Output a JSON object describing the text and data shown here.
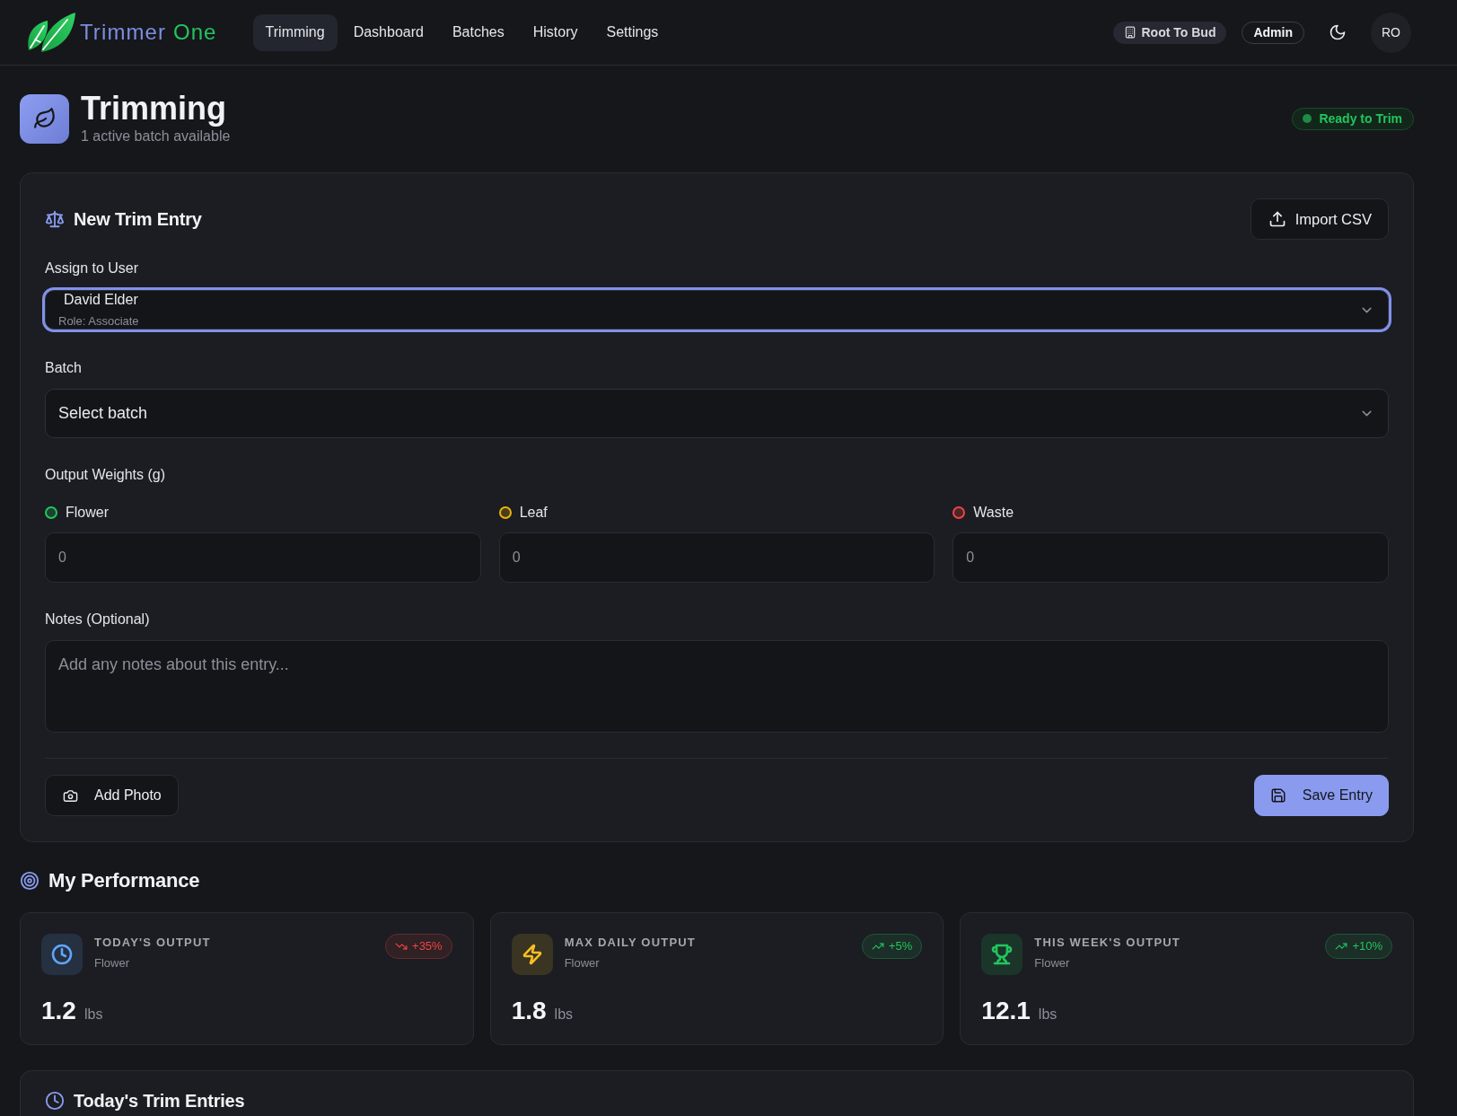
{
  "header": {
    "brand": {
      "name": "Trimmer",
      "suffix": "One"
    },
    "nav": [
      {
        "label": "Trimming",
        "selected": true
      },
      {
        "label": "Dashboard",
        "selected": false
      },
      {
        "label": "Batches",
        "selected": false
      },
      {
        "label": "History",
        "selected": false
      },
      {
        "label": "Settings",
        "selected": false
      }
    ],
    "organization": "Root To Bud",
    "role": "Admin",
    "avatar_initials": "RO"
  },
  "page": {
    "title": "Trimming",
    "subtitle": "1 active batch available",
    "status": "Ready to Trim"
  },
  "trim_form": {
    "title": "New Trim Entry",
    "import_button": "Import CSV",
    "assign_user": {
      "label": "Assign to User",
      "value": "David Elder",
      "detail": "Role: Associate",
      "focused": true
    },
    "batch": {
      "label": "Batch",
      "placeholder": "Select batch"
    },
    "output_weights": {
      "label": "Output Weights (g)",
      "fields": [
        {
          "label": "Flower",
          "color": "#22c55e",
          "placeholder": "0"
        },
        {
          "label": "Leaf",
          "color": "#eab308",
          "placeholder": "0"
        },
        {
          "label": "Waste",
          "color": "#ef4444",
          "placeholder": "0"
        }
      ]
    },
    "notes": {
      "label": "Notes (Optional)",
      "placeholder": "Add any notes about this entry..."
    },
    "add_photo_button": "Add Photo",
    "save_button": "Save Entry"
  },
  "performance": {
    "title": "My Performance",
    "cards": [
      {
        "kind": "daily",
        "title": "TODAY'S OUTPUT",
        "subtitle": "Flower",
        "value": "1.2",
        "unit": "lbs",
        "change": "+35%",
        "trending_up": false,
        "color": "#60a5fa"
      },
      {
        "kind": "peak",
        "title": "MAX DAILY OUTPUT",
        "subtitle": "Flower",
        "value": "1.8",
        "unit": "lbs",
        "change": "+5%",
        "trending_up": true,
        "color": "#fbbf24"
      },
      {
        "kind": "weekly",
        "title": "THIS WEEK'S OUTPUT",
        "subtitle": "Flower",
        "value": "12.1",
        "unit": "lbs",
        "change": "+10%",
        "trending_up": true,
        "color": "#22c55e"
      }
    ]
  },
  "entries": {
    "title": "Today's Trim Entries"
  }
}
